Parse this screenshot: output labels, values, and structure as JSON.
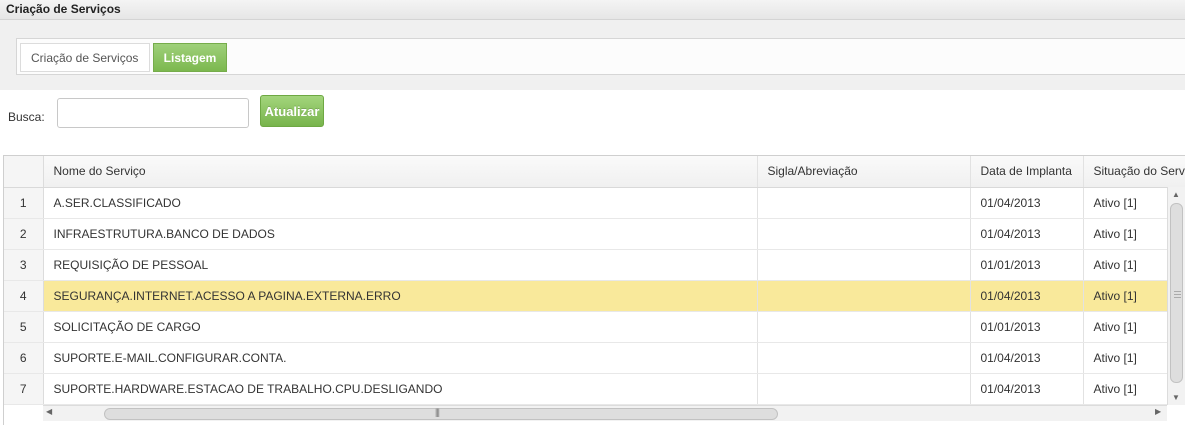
{
  "window": {
    "title": "Criação de Serviços"
  },
  "tabs": [
    {
      "label": "Criação de Serviços",
      "active": false
    },
    {
      "label": "Listagem",
      "active": true
    }
  ],
  "search": {
    "label": "Busca:",
    "value": "",
    "placeholder": ""
  },
  "refresh_button": {
    "label": "Atualizar"
  },
  "grid": {
    "columns": [
      "",
      "Nome do Serviço",
      "Sigla/Abreviação",
      "Data de Implanta",
      "Situação do Serviço"
    ],
    "rows": [
      {
        "num": "1",
        "name": "A.SER.CLASSIFICADO",
        "sigla": "",
        "date": "01/04/2013",
        "status": "Ativo [1]"
      },
      {
        "num": "2",
        "name": "INFRAESTRUTURA.BANCO DE DADOS",
        "sigla": "",
        "date": "01/04/2013",
        "status": "Ativo [1]"
      },
      {
        "num": "3",
        "name": "REQUISIÇÃO DE PESSOAL",
        "sigla": "",
        "date": "01/01/2013",
        "status": "Ativo [1]"
      },
      {
        "num": "4",
        "name": "SEGURANÇA.INTERNET.ACESSO A PAGINA.EXTERNA.ERRO",
        "sigla": "",
        "date": "01/04/2013",
        "status": "Ativo [1]"
      },
      {
        "num": "5",
        "name": "SOLICITAÇÃO DE CARGO",
        "sigla": "",
        "date": "01/01/2013",
        "status": "Ativo [1]"
      },
      {
        "num": "6",
        "name": "SUPORTE.E-MAIL.CONFIGURAR.CONTA.",
        "sigla": "",
        "date": "01/04/2013",
        "status": "Ativo [1]"
      },
      {
        "num": "7",
        "name": "SUPORTE.HARDWARE.ESTACAO DE TRABALHO.CPU.DESLIGANDO",
        "sigla": "",
        "date": "01/04/2013",
        "status": "Ativo [1]"
      }
    ],
    "highlighted_row": "4"
  },
  "colors": {
    "accent_green": "#7cb84f",
    "highlight": "#f9e99b"
  }
}
